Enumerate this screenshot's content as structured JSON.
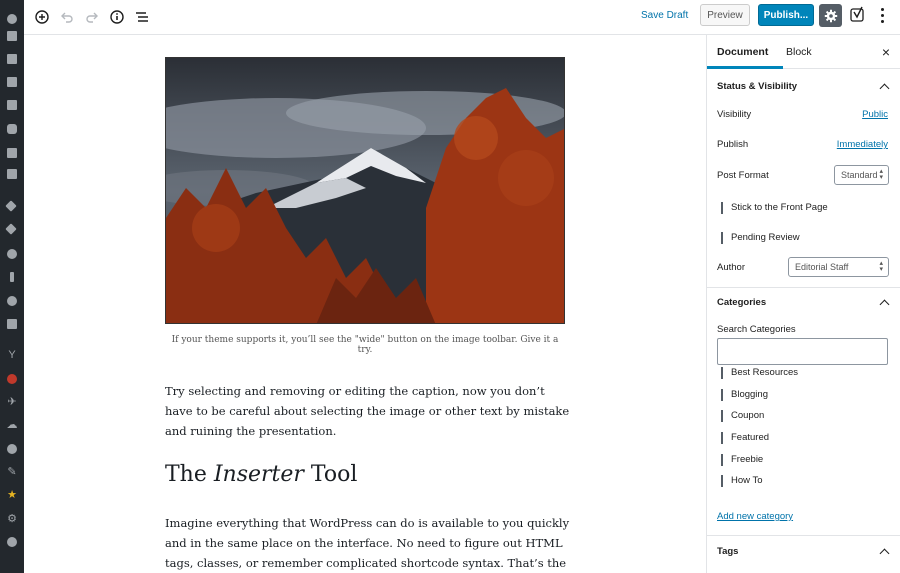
{
  "toolbar": {
    "save_draft": "Save Draft",
    "preview": "Preview",
    "publish": "Publish...",
    "icons": [
      "add-block-icon",
      "undo-icon",
      "redo-icon",
      "info-icon",
      "outline-icon"
    ]
  },
  "admin_menu": {
    "icons": [
      "dashboard-icon",
      "posts-icon",
      "media-icon",
      "pages-icon",
      "comments-icon",
      "table-icon",
      "grid-icon",
      "appearance-icon",
      "plugins-icon",
      "users-icon",
      "tools-icon",
      "bubble-icon",
      "settings-icon",
      "yoast-icon",
      "badge-icon",
      "plane-icon",
      "cloud-icon",
      "bolt-icon",
      "pen-icon",
      "star-icon",
      "gear-icon",
      "circle-icon"
    ]
  },
  "content": {
    "caption": "If your theme supports it, you’ll see the \"wide\" button on the image toolbar. Give it a try.",
    "para1": "Try selecting and removing or editing the caption, now you don’t have to be careful about selecting the image or other text by mistake and ruining the presentation.",
    "heading_pre": "The ",
    "heading_em": "Inserter",
    "heading_post": " Tool",
    "para2": "Imagine everything that WordPress can do is available to you quickly and in the same place on the interface. No need to figure out HTML tags, classes, or remember complicated shortcode syntax. That’s the spirit behind the"
  },
  "panel": {
    "tab_document": "Document",
    "tab_block": "Block",
    "close": "×",
    "status": {
      "title": "Status & Visibility",
      "visibility_label": "Visibility",
      "visibility_value": "Public",
      "publish_label": "Publish",
      "publish_value": "Immediately",
      "format_label": "Post Format",
      "format_value": "Standard",
      "stick": "Stick to the Front Page",
      "pending": "Pending Review",
      "author_label": "Author",
      "author_value": "Editorial Staff"
    },
    "categories": {
      "title": "Categories",
      "search_label": "Search Categories",
      "items": [
        "Best Resources",
        "Blogging",
        "Coupon",
        "Featured",
        "Freebie",
        "How To"
      ],
      "add_new": "Add new category"
    },
    "tags": {
      "title": "Tags"
    }
  }
}
